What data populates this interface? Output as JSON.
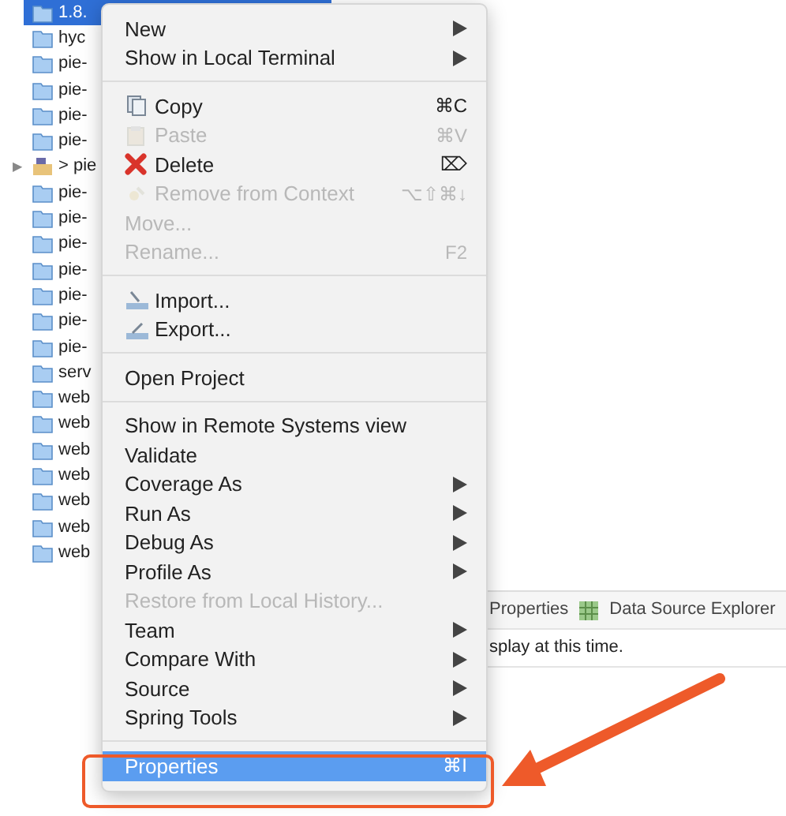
{
  "project_tree": {
    "items": [
      {
        "label": "1.8.",
        "kind": "folder",
        "selected": true
      },
      {
        "label": "hyc",
        "kind": "folder",
        "selected": false
      },
      {
        "label": "pie-",
        "kind": "folder",
        "selected": false
      },
      {
        "label": "pie-",
        "kind": "folder",
        "selected": false
      },
      {
        "label": "pie-",
        "kind": "folder",
        "selected": false
      },
      {
        "label": "pie-",
        "kind": "folder",
        "selected": false
      },
      {
        "label": "> pie",
        "kind": "project",
        "expander": "▶",
        "selected": false
      },
      {
        "label": "pie-",
        "kind": "folder",
        "selected": false
      },
      {
        "label": "pie-",
        "kind": "folder",
        "selected": false
      },
      {
        "label": "pie-",
        "kind": "folder",
        "selected": false
      },
      {
        "label": "pie-",
        "kind": "folder",
        "selected": false
      },
      {
        "label": "pie-",
        "kind": "folder",
        "selected": false
      },
      {
        "label": "pie-",
        "kind": "folder",
        "selected": false
      },
      {
        "label": "pie-",
        "kind": "folder",
        "selected": false
      },
      {
        "label": "serv",
        "kind": "folder",
        "selected": false
      },
      {
        "label": "web",
        "kind": "folder",
        "selected": false
      },
      {
        "label": "web",
        "kind": "folder",
        "selected": false
      },
      {
        "label": "web",
        "kind": "folder",
        "selected": false
      },
      {
        "label": "web",
        "kind": "folder",
        "selected": false
      },
      {
        "label": "web",
        "kind": "folder",
        "selected": false
      },
      {
        "label": "web",
        "kind": "folder",
        "selected": false
      },
      {
        "label": "web",
        "kind": "folder",
        "selected": false
      }
    ]
  },
  "background_view": {
    "tabs": [
      "Properties",
      "Data Source Explorer"
    ],
    "message": "splay at this time."
  },
  "context_menu": {
    "items": [
      {
        "kind": "item",
        "label": "New",
        "submenu": true,
        "disabled": false,
        "selected": false
      },
      {
        "kind": "item",
        "label": "Show in Local Terminal",
        "submenu": true,
        "disabled": false,
        "selected": false
      },
      {
        "kind": "separator"
      },
      {
        "kind": "icon_item",
        "label": "Copy",
        "shortcut": "⌘C",
        "disabled": false,
        "selected": false
      },
      {
        "kind": "icon_item",
        "label": "Paste",
        "shortcut": "⌘V",
        "disabled": true,
        "selected": false
      },
      {
        "kind": "icon_item",
        "label": "Delete",
        "shortcut": "⌦",
        "disabled": false,
        "selected": false
      },
      {
        "kind": "icon_item",
        "label": "Remove from Context",
        "shortcut": "⌥⇧⌘↓",
        "disabled": true,
        "selected": false
      },
      {
        "kind": "item",
        "label": "Move...",
        "disabled": true,
        "selected": false
      },
      {
        "kind": "item",
        "label": "Rename...",
        "shortcut": "F2",
        "disabled": true,
        "selected": false
      },
      {
        "kind": "separator"
      },
      {
        "kind": "icon_item",
        "label": "Import...",
        "disabled": false,
        "selected": false
      },
      {
        "kind": "icon_item",
        "label": "Export...",
        "disabled": false,
        "selected": false
      },
      {
        "kind": "separator"
      },
      {
        "kind": "item",
        "label": "Open Project",
        "disabled": false,
        "selected": false
      },
      {
        "kind": "separator"
      },
      {
        "kind": "item",
        "label": "Show in Remote Systems view",
        "disabled": false,
        "selected": false
      },
      {
        "kind": "item",
        "label": "Validate",
        "disabled": false,
        "selected": false
      },
      {
        "kind": "item",
        "label": "Coverage As",
        "submenu": true,
        "disabled": false,
        "selected": false
      },
      {
        "kind": "item",
        "label": "Run As",
        "submenu": true,
        "disabled": false,
        "selected": false
      },
      {
        "kind": "item",
        "label": "Debug As",
        "submenu": true,
        "disabled": false,
        "selected": false
      },
      {
        "kind": "item",
        "label": "Profile As",
        "submenu": true,
        "disabled": false,
        "selected": false
      },
      {
        "kind": "item",
        "label": "Restore from Local History...",
        "disabled": true,
        "selected": false
      },
      {
        "kind": "item",
        "label": "Team",
        "submenu": true,
        "disabled": false,
        "selected": false
      },
      {
        "kind": "item",
        "label": "Compare With",
        "submenu": true,
        "disabled": false,
        "selected": false
      },
      {
        "kind": "item",
        "label": "Source",
        "submenu": true,
        "disabled": false,
        "selected": false
      },
      {
        "kind": "item",
        "label": "Spring Tools",
        "submenu": true,
        "disabled": false,
        "selected": false
      },
      {
        "kind": "separator"
      },
      {
        "kind": "item",
        "label": "Properties",
        "shortcut": "⌘I",
        "disabled": false,
        "selected": true,
        "highlighted": true
      }
    ]
  }
}
